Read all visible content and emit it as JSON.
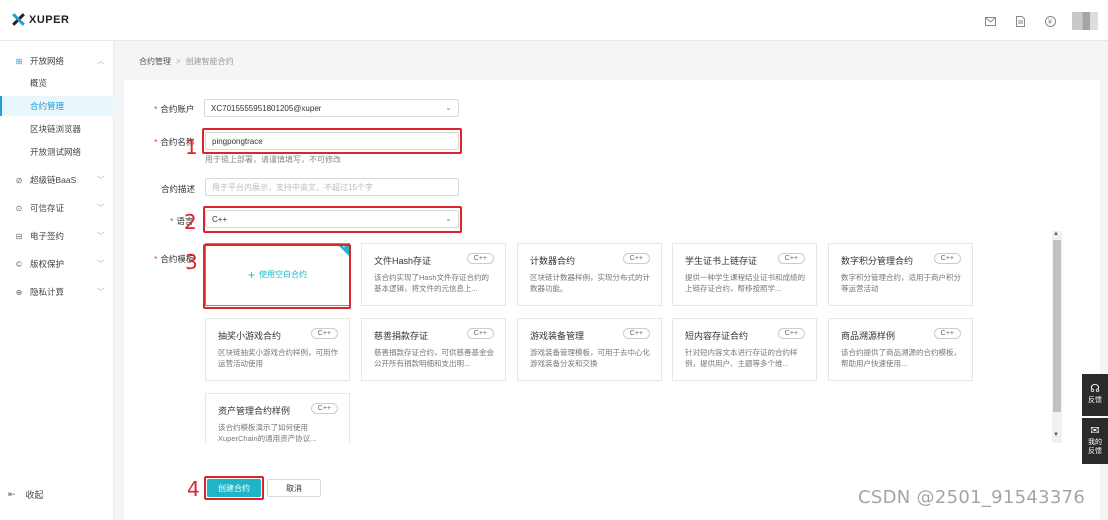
{
  "app": {
    "logo_text": "XUPER"
  },
  "header_icons": [
    "message-icon",
    "document-icon",
    "currency-icon",
    "avatar"
  ],
  "sidebar": {
    "groups": [
      {
        "label": "开放网络",
        "icon": "network-icon",
        "expanded": true,
        "items": [
          {
            "label": "概览"
          },
          {
            "label": "合约管理",
            "active": true
          },
          {
            "label": "区块链浏览器"
          },
          {
            "label": "开放测试网络"
          }
        ]
      },
      {
        "label": "超级链BaaS",
        "icon": "baas-icon"
      },
      {
        "label": "可信存证",
        "icon": "evidence-icon"
      },
      {
        "label": "电子签约",
        "icon": "sign-icon"
      },
      {
        "label": "版权保护",
        "icon": "copyright-icon"
      },
      {
        "label": "隐私计算",
        "icon": "privacy-icon"
      }
    ],
    "collapse_label": "收起"
  },
  "breadcrumb": {
    "parent": "合约管理",
    "sep": ">",
    "current": "创建智能合约"
  },
  "form": {
    "account": {
      "label": "合约账户",
      "value": "XC7015555951801205@xuper"
    },
    "name": {
      "label": "合约名称",
      "value": "pingpongtrace",
      "hint": "用于链上部署，请谨慎填写，不可修改"
    },
    "desc": {
      "label": "合约描述",
      "placeholder": "用于平台内展示，支持中英文，不超过15个字"
    },
    "language": {
      "label": "语言",
      "value": "C++"
    },
    "template": {
      "label": "合约模板",
      "empty_label": "使用空白合约"
    }
  },
  "templates": [
    {
      "title": "文件Hash存证",
      "lang": "C++",
      "desc": "该合约实现了Hash文件存证合约的基本逻辑，将文件的元信息上..."
    },
    {
      "title": "计数器合约",
      "lang": "C++",
      "desc": "区块链计数器样例，实现分布式的计数器功能。"
    },
    {
      "title": "学生证书上链存证",
      "lang": "C++",
      "desc": "提供一种学生课程结业证书和成绩的上链存证合约，帮移按照学..."
    },
    {
      "title": "数字积分管理合约",
      "lang": "C++",
      "desc": "数字积分管理合约，适用于商户积分等运营活动"
    },
    {
      "title": "抽奖小游戏合约",
      "lang": "C++",
      "desc": "区块链抽奖小游戏合约样例，可用作运营活动使用"
    },
    {
      "title": "慈善捐款存证",
      "lang": "C++",
      "desc": "慈善捐款存证合约，可供慈善基金会公开所有捐款明细和支出明..."
    },
    {
      "title": "游戏装备管理",
      "lang": "C++",
      "desc": "游戏装备管理模板，可用于去中心化游戏装备分发和交换"
    },
    {
      "title": "短内容存证合约",
      "lang": "C++",
      "desc": "针对短内容文本进行存证的合约样例，提供用户、主题等多个维..."
    },
    {
      "title": "商品溯源样例",
      "lang": "C++",
      "desc": "该合约提供了商品溯源的合约模板，帮助用户快速使用..."
    },
    {
      "title": "资产管理合约样例",
      "lang": "C++",
      "desc": "该合约模板演示了如何使用XuperChain的通用资产协议..."
    }
  ],
  "buttons": {
    "create": "创建合约",
    "cancel": "取消"
  },
  "annotations": [
    "1",
    "2",
    "3",
    "4"
  ],
  "float": {
    "feedback": "反馈",
    "my_feedback": "我的反馈"
  },
  "watermark": "CSDN @2501_91543376",
  "colors": {
    "accent": "#1fb5c7",
    "annotation": "#d9262c",
    "link": "#1f9fd6"
  }
}
